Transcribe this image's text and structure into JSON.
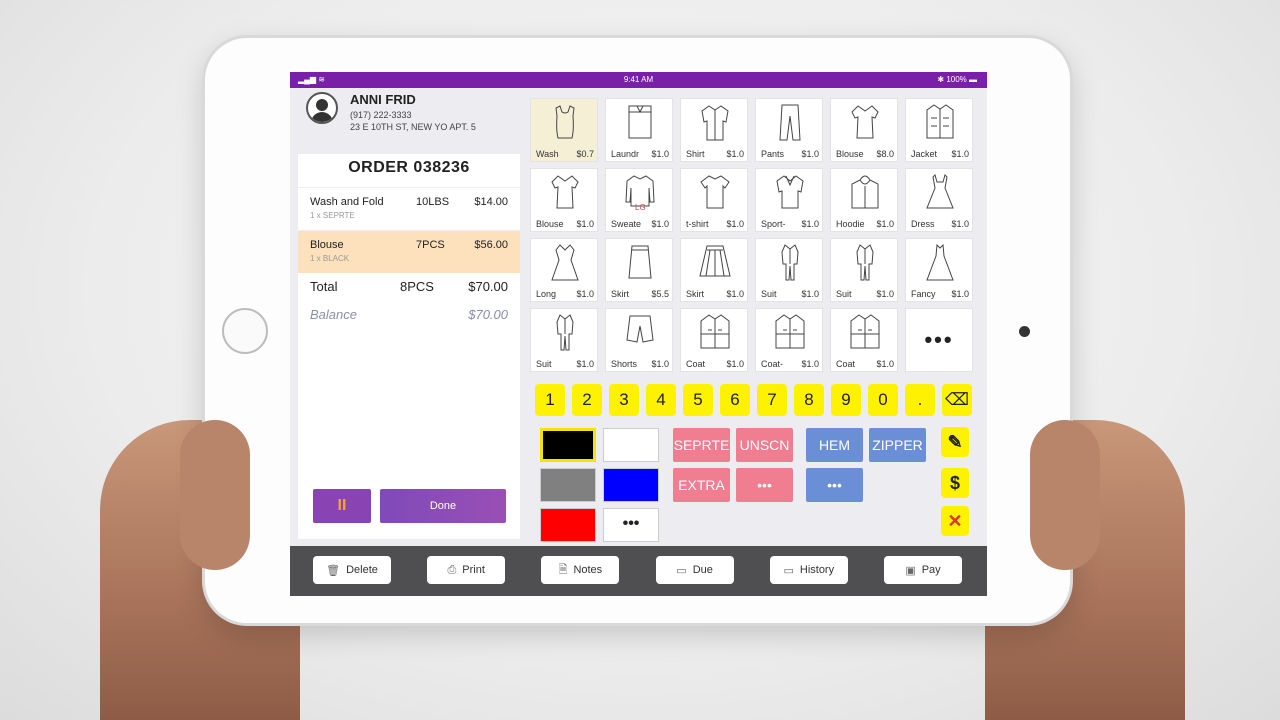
{
  "status": {
    "time": "9:41 AM",
    "signal": "▂▄▆ ≋",
    "battery": "✱ 100% ▬"
  },
  "customer": {
    "name": "ANNI FRID",
    "phone": "(917) 222-3333",
    "address": "23 E 10TH ST, NEW YO APT. 5"
  },
  "order": {
    "title": "ORDER 038236",
    "lines": [
      {
        "name": "Wash and Fold",
        "qty": "10LBS",
        "price": "$14.00",
        "sub": "1 x SEPRTE"
      },
      {
        "name": "Blouse",
        "qty": "7PCS",
        "price": "$56.00",
        "sub": "1 x BLACK"
      }
    ],
    "total_label": "Total",
    "total_qty": "8PCS",
    "total_value": "$70.00",
    "balance_label": "Balance",
    "balance_value": "$70.00",
    "pause_label": "II",
    "done_label": "Done"
  },
  "garments": [
    {
      "name": "Wash",
      "price": "$0.7",
      "icon": "tank-top-icon"
    },
    {
      "name": "Laundr",
      "price": "$1.0",
      "icon": "folded-shirt-icon"
    },
    {
      "name": "Shirt",
      "price": "$1.0",
      "icon": "shirt-icon"
    },
    {
      "name": "Pants",
      "price": "$1.0",
      "icon": "pants-icon"
    },
    {
      "name": "Blouse",
      "price": "$8.0",
      "icon": "blouse-icon"
    },
    {
      "name": "Jacket",
      "price": "$1.0",
      "icon": "jacket-icon"
    },
    {
      "name": "Blouse",
      "price": "$1.0",
      "icon": "blouse-icon"
    },
    {
      "name": "Sweate",
      "price": "$1.0",
      "icon": "sweater-icon",
      "tag": "LG"
    },
    {
      "name": "t-shirt",
      "price": "$1.0",
      "icon": "tshirt-icon"
    },
    {
      "name": "Sport-",
      "price": "$1.0",
      "icon": "sport-shirt-icon"
    },
    {
      "name": "Hoodie",
      "price": "$1.0",
      "icon": "hoodie-icon"
    },
    {
      "name": "Dress",
      "price": "$1.0",
      "icon": "dress-icon"
    },
    {
      "name": "Long",
      "price": "$1.0",
      "icon": "long-dress-icon"
    },
    {
      "name": "Skirt",
      "price": "$5.5",
      "icon": "skirt-icon"
    },
    {
      "name": "Skirt",
      "price": "$1.0",
      "icon": "pleated-skirt-icon"
    },
    {
      "name": "Suit",
      "price": "$1.0",
      "icon": "suit-icon"
    },
    {
      "name": "Suit",
      "price": "$1.0",
      "icon": "suit-icon"
    },
    {
      "name": "Fancy",
      "price": "$1.0",
      "icon": "gown-icon"
    },
    {
      "name": "Suit",
      "price": "$1.0",
      "icon": "suit-icon"
    },
    {
      "name": "Shorts",
      "price": "$1.0",
      "icon": "shorts-icon"
    },
    {
      "name": "Coat",
      "price": "$1.0",
      "icon": "coat-icon"
    },
    {
      "name": "Coat-",
      "price": "$1.0",
      "icon": "coat-icon"
    },
    {
      "name": "Coat",
      "price": "$1.0",
      "icon": "coat-icon"
    },
    {
      "name": "•••",
      "price": "",
      "icon": "more-icon"
    }
  ],
  "keys": [
    "1",
    "2",
    "3",
    "4",
    "5",
    "6",
    "7",
    "8",
    "9",
    "0",
    ".",
    "⌫"
  ],
  "colors": [
    {
      "name": "black",
      "hex": "#000000"
    },
    {
      "name": "white",
      "hex": "#ffffff"
    },
    {
      "name": "gray",
      "hex": "#808080"
    },
    {
      "name": "blue",
      "hex": "#0000ff"
    },
    {
      "name": "red",
      "hex": "#ff0000"
    }
  ],
  "color_more": "•••",
  "options_pink": [
    "SEPRTE",
    "UNSCN",
    "EXTRA",
    "•••"
  ],
  "options_blue": [
    "HEM",
    "ZIPPER",
    "•••"
  ],
  "side_buttons": {
    "edit": "✎",
    "price": "$",
    "clear": "✕"
  },
  "toolbar": [
    "Delete",
    "Print",
    "Notes",
    "Due",
    "History",
    "Pay"
  ],
  "toolbar_icons": [
    "🗑",
    "⎙",
    "🗎",
    "▭",
    "▭",
    "▣"
  ]
}
